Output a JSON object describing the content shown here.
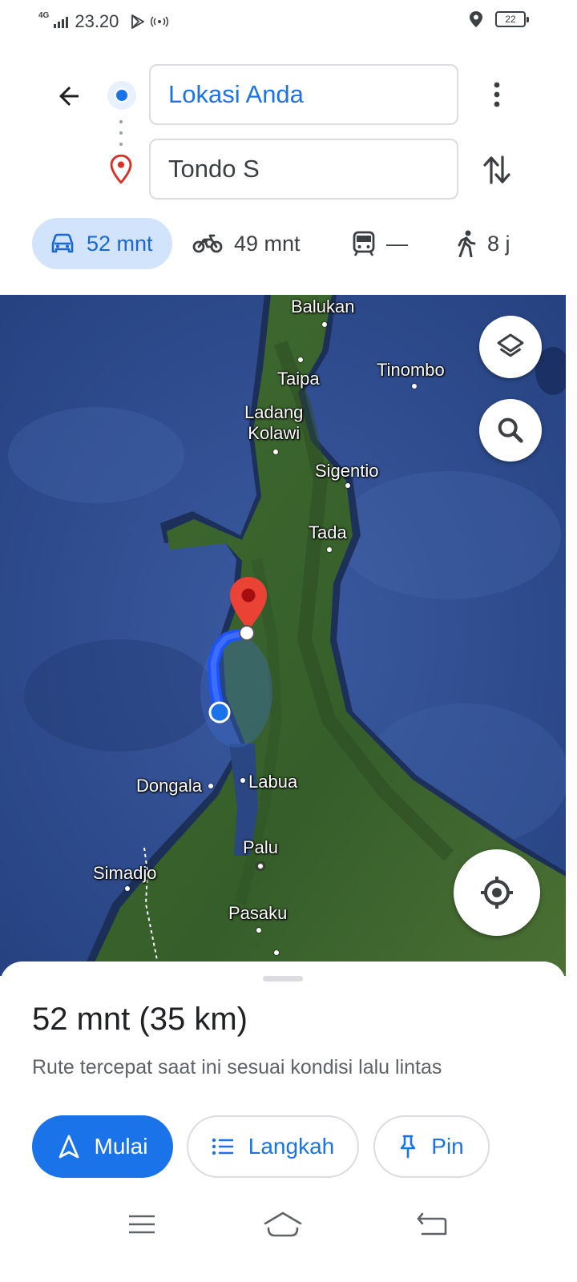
{
  "status_bar": {
    "network": "4G",
    "time": "23.20",
    "battery": "22",
    "icons": [
      "signal-icon",
      "play-store-icon",
      "hotspot-icon",
      "location-icon",
      "battery-icon"
    ]
  },
  "directions": {
    "origin": "Lokasi Anda",
    "destination": "Tondo S"
  },
  "modes": [
    {
      "name": "car",
      "icon": "car-icon",
      "label": "52 mnt",
      "active": true
    },
    {
      "name": "motorcycle",
      "icon": "motorcycle-icon",
      "label": "49 mnt",
      "active": false
    },
    {
      "name": "transit",
      "icon": "train-icon",
      "label": "—",
      "active": false
    },
    {
      "name": "walk",
      "icon": "walk-icon",
      "label": "8 j",
      "active": false
    }
  ],
  "map": {
    "places": [
      "Balukan",
      "Taipa",
      "Tinombo",
      "Ladang\nKolawi",
      "Sigentio",
      "Tada",
      "Dongala",
      "Labua",
      "Palu",
      "Simadjo",
      "Pasaku"
    ],
    "colors": {
      "route": "#1a53ff",
      "destination_pin": "#ea4335",
      "sea": "#2d4a8a",
      "land": "#3e6a2e"
    }
  },
  "sheet": {
    "summary": "52 mnt (35 km)",
    "subtitle": "Rute tercepat saat ini sesuai kondisi lalu lintas",
    "start_label": "Mulai",
    "steps_label": "Langkah",
    "pin_label": "Pin"
  },
  "colors": {
    "accent": "#1a73e8",
    "accent_light": "#d2e3fc"
  }
}
